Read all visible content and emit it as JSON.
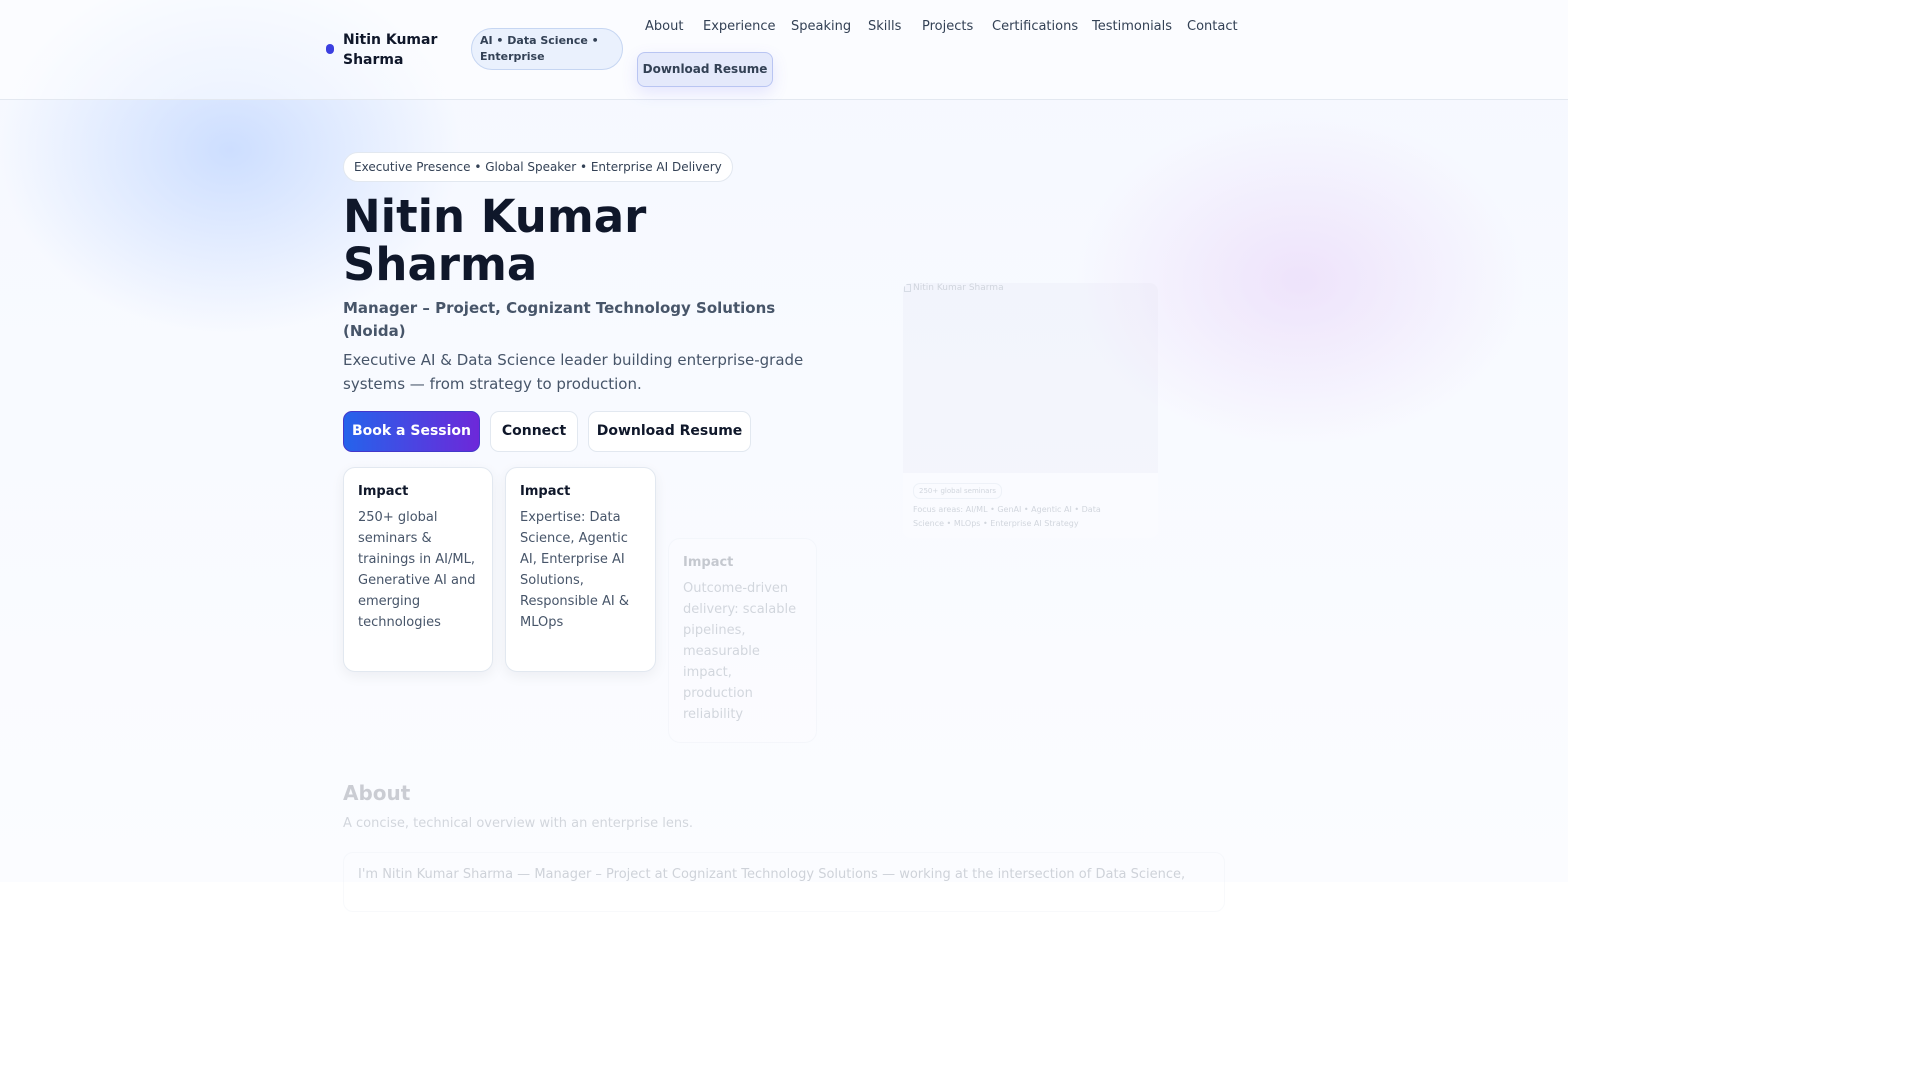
{
  "header": {
    "brand_name": "Nitin Kumar Sharma",
    "tag": "AI • Data Science • Enterprise",
    "nav": [
      "About",
      "Experience",
      "Speaking",
      "Skills",
      "Projects",
      "Certifications",
      "Testimonials",
      "Contact"
    ],
    "resume_button": "Download Resume"
  },
  "hero": {
    "eyebrow": "Executive Presence • Global Speaker • Enterprise AI Delivery",
    "name": "Nitin Kumar Sharma",
    "role": "Manager – Project, Cognizant Technology Solutions (Noida)",
    "tagline": "Executive AI & Data Science leader building enterprise-grade systems — from strategy to production.",
    "buttons": {
      "book": "Book a Session",
      "connect": "Connect",
      "resume": "Download Resume"
    },
    "cards": [
      {
        "title": "Impact",
        "body": "250+ global seminars & trainings in AI/ML, Generative AI and emerging technologies"
      },
      {
        "title": "Impact",
        "body": "Expertise: Data Science, Agentic AI, Enterprise AI Solutions, Responsible AI & MLOps"
      },
      {
        "title": "Impact",
        "body": "Outcome-driven delivery: scalable pipelines, measurable impact, production reliability"
      }
    ],
    "portrait": {
      "alt": "Nitin Kumar Sharma",
      "chip": "250+ global seminars",
      "focus": "Focus areas: AI/ML • GenAI • Agentic AI • Data Science • MLOps • Enterprise AI Strategy"
    }
  },
  "about": {
    "title": "About",
    "subtitle": "A concise, technical overview with an enterprise lens.",
    "text": "I'm Nitin Kumar Sharma — Manager – Project at Cognizant Technology Solutions — working at the intersection of Data Science,"
  }
}
